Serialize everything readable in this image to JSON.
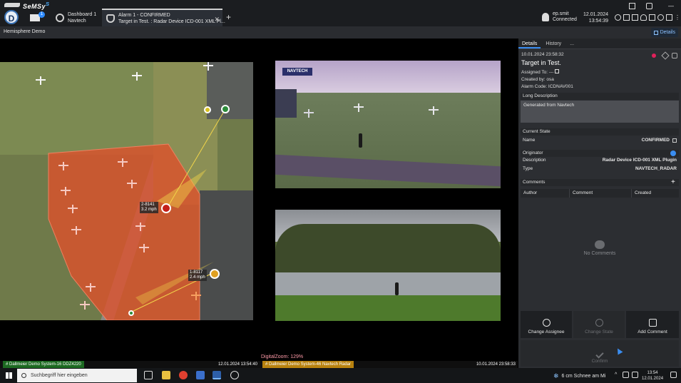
{
  "brand": {
    "name": "SeMSy",
    "suffix": "S",
    "logo_letter": "D"
  },
  "mail_badge": "1",
  "tabs": [
    {
      "title": "Dashboard 1",
      "subtitle": "Navtech"
    },
    {
      "title": "Alarm 1 - CONFIRMED",
      "subtitle": "Target in Test. : Radar Device ICD-001 XML Pl..."
    }
  ],
  "user": {
    "name": "ep.smit",
    "status": "Connected"
  },
  "clock": {
    "date": "12.01.2024",
    "time": "13:54:39"
  },
  "subheader": {
    "title": "Hemisphere Demo",
    "details_button": "Details"
  },
  "map": {
    "targets": [
      {
        "id": "2-8141",
        "speed": "3.2 mph"
      },
      {
        "id": "1-8117",
        "speed": "2.4 mph"
      }
    ]
  },
  "video": {
    "overlay_logo": "NAVTECH",
    "digital_zoom": "DigitalZoom: 129%"
  },
  "cameras": [
    {
      "label": "# Dallmeier Demo System-16  DDZ4220",
      "time": "12.01.2024 13:54:40"
    },
    {
      "label": "# Dallmeier Demo System-46  Navtech Radar",
      "time": "10.01.2024 23:58:33"
    }
  ],
  "panel": {
    "tabs": [
      "Details",
      "History",
      "..."
    ],
    "timestamp": "10.01.2024  23:58:32",
    "title": "Target in Test.",
    "assigned_to": "Assigned To: ---",
    "created_by": "Created by: osa",
    "alarm_code": "Alarm Code: ICDNAV001",
    "long_description_header": "Long Description",
    "long_description": "Generated from Navtech",
    "current_state_header": "Current State",
    "state_label": "Name",
    "state_value": "CONFIRMED",
    "originator_header": "Originator",
    "originator_desc_label": "Description",
    "originator_desc_value": "Radar Device ICD-001 XML Plugin",
    "originator_type_label": "Type",
    "originator_type_value": "NAVTECH_RADAR",
    "comments_header": "Comments",
    "comment_columns": [
      "Author",
      "Comment",
      "Created"
    ],
    "no_comments": "No Comments",
    "actions": [
      "Change Assignee",
      "Change State",
      "Add Comment"
    ],
    "confirm": "Confirm"
  },
  "taskbar": {
    "search_placeholder": "Suchbegriff hier eingeben",
    "weather": "6 cm Schnee am Mi",
    "time": "13:54",
    "date": "12.01.2024"
  },
  "colors": {
    "accent": "#3a8df0",
    "alarm_zone": "#e0502a",
    "cam1_label": "#1d6a22",
    "cam2_label": "#b8820f"
  }
}
